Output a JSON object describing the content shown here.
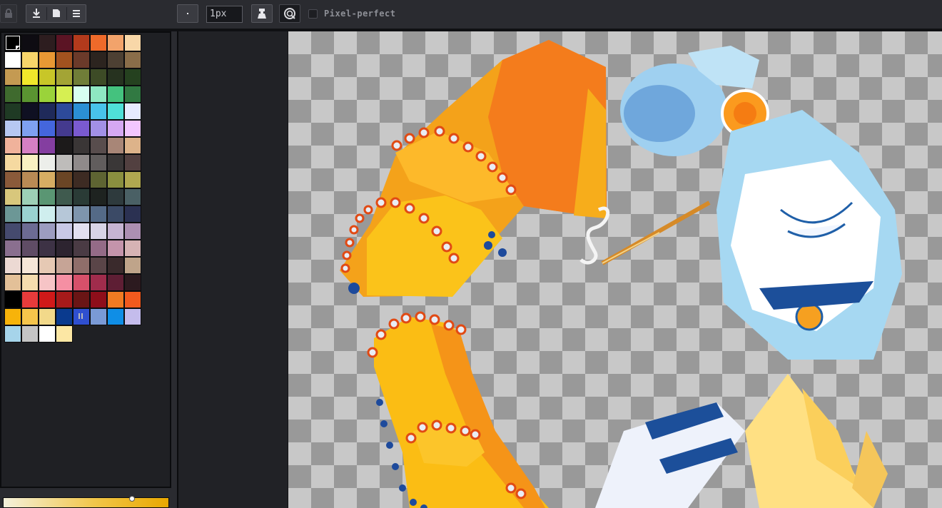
{
  "toolbar": {
    "brush_size": "1px",
    "pixel_perfect_label": "Pixel-perfect",
    "pixel_perfect_checked": false
  },
  "palette": {
    "selected_index": 0,
    "colors": [
      "#000000",
      "#0e0c12",
      "#2d1d1f",
      "#5b1424",
      "#b33a1c",
      "#ef6a2a",
      "#f2a36b",
      "#f8d7a8",
      "#ffffff",
      "#f7d56a",
      "#e89834",
      "#a2521f",
      "#6b3a2a",
      "#2c241f",
      "#4d4033",
      "#8a6d49",
      "#c49a52",
      "#f1e72b",
      "#c8c628",
      "#a3a435",
      "#707d38",
      "#3d4b26",
      "#26321f",
      "#25411f",
      "#3f6a2e",
      "#5a9431",
      "#9ad33a",
      "#d6ef52",
      "#d7fff1",
      "#8ee8c2",
      "#44c27e",
      "#317942",
      "#1f3a24",
      "#0f1022",
      "#1f2a5a",
      "#2d4a9a",
      "#2b8fd4",
      "#48c3ea",
      "#4fe0d8",
      "#e6ebff",
      "#b6c8f2",
      "#7ea0f0",
      "#4466dd",
      "#443a8e",
      "#7a5ad0",
      "#a290e6",
      "#d5a8f2",
      "#f2c6ff",
      "#f0b29b",
      "#d680c4",
      "#843ea0",
      "#1c1a1a",
      "#3a3636",
      "#584d4d",
      "#a88677",
      "#ddb38a",
      "#f5d9a0",
      "#f8f1c2",
      "#eceeea",
      "#bebcba",
      "#8f8a8a",
      "#615d5d",
      "#3a3737",
      "#524040",
      "#8a5a3a",
      "#b98a55",
      "#d6ad63",
      "#6a4525",
      "#3d2b23",
      "#5e6432",
      "#8a8f3f",
      "#b0a850",
      "#d8c77c",
      "#9dd0b6",
      "#5a9673",
      "#3f5a4e",
      "#2a3b36",
      "#1e2320",
      "#2e3a3d",
      "#4a6065",
      "#6c9796",
      "#9ad2d0",
      "#cfeeee",
      "#b6c7d8",
      "#7e95ad",
      "#546a87",
      "#3b4a66",
      "#2b3152",
      "#454a6e",
      "#6c6b93",
      "#9c9cc0",
      "#c8c8e6",
      "#e2e0f0",
      "#d8d4e6",
      "#c6b4d2",
      "#ac8fb2",
      "#8a6f8f",
      "#5f4c65",
      "#3d3245",
      "#2d2430",
      "#4a3b44",
      "#946b87",
      "#c494ab",
      "#d6b3b4",
      "#ecd9d3",
      "#f6e7d8",
      "#e6c9b4",
      "#c6a496",
      "#8f6e6a",
      "#5a4548",
      "#3a2a2c",
      "#bfa48a",
      "#e3c098",
      "#f5dcae",
      "#f6c4c6",
      "#f58fa3",
      "#d6506a",
      "#a02c4c",
      "#5e1e34",
      "#2c1a1f",
      "#000000",
      "#e83b3b",
      "#d01919",
      "#a61a1a",
      "#6a1515",
      "#8e0e1a",
      "#f07a22",
      "#f25a1e",
      "#f7b30a",
      "#f6c54b",
      "#f2d98a",
      "#0a3a8e",
      "#2f4fd0",
      "#7a9ad6",
      "#0f8ee6",
      "#c4bcec",
      "#a6d4ea",
      "#c4c4c4",
      "#ffffff",
      "#fce7a4"
    ]
  },
  "icons": {
    "lock": "lock-icon",
    "export": "download-icon",
    "save": "document-icon",
    "menu": "hamburger-menu-icon",
    "brush_shape": "dot-icon",
    "ink": "ink-pot-icon",
    "symmetry": "target-icon"
  }
}
